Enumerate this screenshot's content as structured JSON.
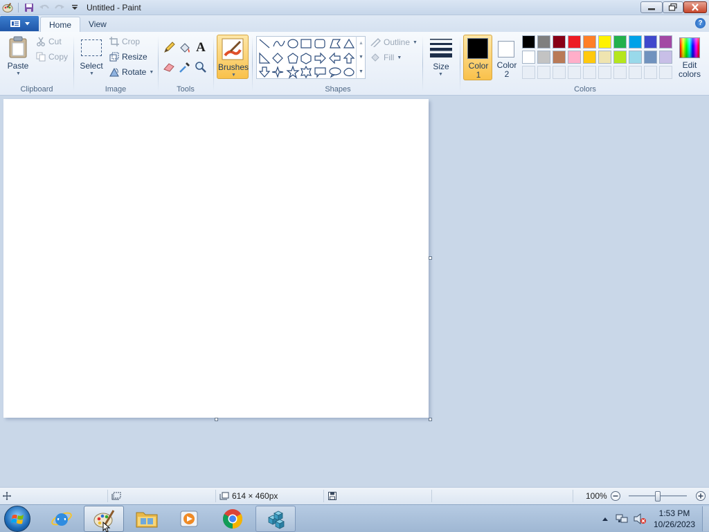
{
  "window": {
    "title": "Untitled - Paint"
  },
  "tabs": {
    "home": "Home",
    "view": "View"
  },
  "help": "?",
  "clipboard": {
    "paste": "Paste",
    "cut": "Cut",
    "copy": "Copy",
    "group": "Clipboard"
  },
  "image": {
    "select": "Select",
    "crop": "Crop",
    "resize": "Resize",
    "rotate": "Rotate",
    "group": "Image"
  },
  "tools": {
    "group": "Tools",
    "text_glyph": "A"
  },
  "brushes": {
    "label": "Brushes"
  },
  "shapes": {
    "group": "Shapes",
    "outline": "Outline",
    "fill": "Fill"
  },
  "size": {
    "label": "Size"
  },
  "colors": {
    "color1_line1": "Color",
    "color1_line2": "1",
    "color2_line1": "Color",
    "color2_line2": "2",
    "edit_line1": "Edit",
    "edit_line2": "colors",
    "group": "Colors",
    "color1_value": "#000000",
    "color2_value": "#ffffff",
    "palette_row1": [
      "#000000",
      "#7f7f7f",
      "#880015",
      "#ed1c24",
      "#ff7f27",
      "#fff200",
      "#22b14c",
      "#00a2e8",
      "#3f48cc",
      "#a349a4"
    ],
    "palette_row2": [
      "#ffffff",
      "#c3c3c3",
      "#b97a57",
      "#ffaec9",
      "#ffc90e",
      "#efe4b0",
      "#b5e61d",
      "#99d9ea",
      "#7092be",
      "#c8bfe7"
    ]
  },
  "status": {
    "dimensions": "614 × 460px",
    "zoom": "100%",
    "zoom_level_fraction": 0.5
  },
  "taskbar": {
    "time": "1:53 PM",
    "date": "10/26/2023"
  }
}
